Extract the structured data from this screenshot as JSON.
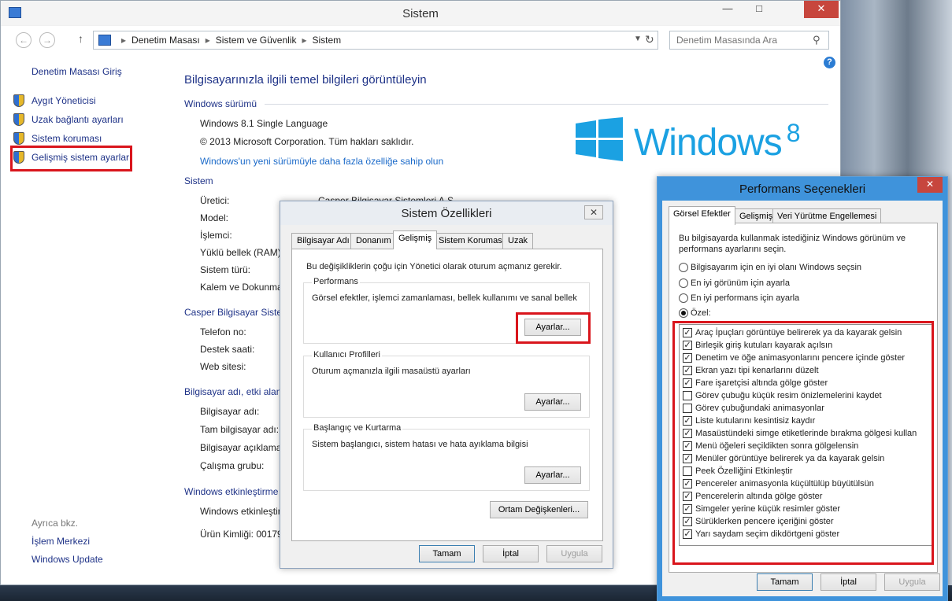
{
  "window": {
    "title": "Sistem",
    "min": "—",
    "max": "□",
    "close": "✕"
  },
  "address": {
    "crumbs": [
      "Denetim Masası",
      "Sistem ve Güvenlik",
      "Sistem"
    ],
    "search_placeholder": "Denetim Masasında Ara"
  },
  "sidebar": {
    "home": "Denetim Masası Giriş",
    "items": [
      {
        "label": "Aygıt Yöneticisi",
        "icon": "shield-icon"
      },
      {
        "label": "Uzak bağlantı ayarları",
        "icon": "shield-icon"
      },
      {
        "label": "Sistem koruması",
        "icon": "shield-icon"
      },
      {
        "label": "Gelişmiş sistem ayarları",
        "icon": "shield-icon"
      }
    ],
    "see_also": "Ayrıca bkz.",
    "see_also_items": [
      "İşlem Merkezi",
      "Windows Update"
    ]
  },
  "main": {
    "heading": "Bilgisayarınızla ilgili temel bilgileri görüntüleyin",
    "edition_head": "Windows sürümü",
    "edition": "Windows 8.1 Single Language",
    "copyright": "© 2013 Microsoft Corporation. Tüm hakları saklıdır.",
    "upgrade_link": "Windows'un yeni sürümüyle daha fazla özelliğe sahip olun",
    "logo_text": "Windows",
    "logo_version": "8",
    "system_head": "Sistem",
    "system_rows": [
      {
        "label": "Üretici:",
        "value": "Casper Bilgisayar Sistemleri A.Ş."
      },
      {
        "label": "Model:",
        "value": ""
      },
      {
        "label": "İşlemci:",
        "value": ""
      },
      {
        "label": "Yüklü bellek (RAM):",
        "value": ""
      },
      {
        "label": "Sistem türü:",
        "value": ""
      },
      {
        "label": "Kalem ve Dokunma:",
        "value": ""
      }
    ],
    "support_head": "Casper Bilgisayar Sistemleri",
    "support_rows": [
      "Telefon no:",
      "Destek saati:",
      "Web sitesi:"
    ],
    "name_head": "Bilgisayar adı, etki alanı",
    "name_rows": [
      "Bilgisayar adı:",
      "Tam bilgisayar adı:",
      "Bilgisayar açıklaması:",
      "Çalışma grubu:"
    ],
    "activation_head": "Windows etkinleştirme",
    "activation_rows": [
      "Windows etkinleştirme",
      "Ürün Kimliği: 00179"
    ]
  },
  "props_dialog": {
    "title": "Sistem Özellikleri",
    "close": "✕",
    "tabs": [
      "Bilgisayar Adı",
      "Donanım",
      "Gelişmiş",
      "Sistem Koruması",
      "Uzak"
    ],
    "admin_note": "Bu değişikliklerin çoğu için Yönetici olarak oturum açmanız gerekir.",
    "groups": [
      {
        "title": "Performans",
        "text": "Görsel efektler, işlemci zamanlaması, bellek kullanımı ve sanal bellek",
        "button": "Ayarlar..."
      },
      {
        "title": "Kullanıcı Profilleri",
        "text": "Oturum açmanızla ilgili masaüstü ayarları",
        "button": "Ayarlar..."
      },
      {
        "title": "Başlangıç ve Kurtarma",
        "text": "Sistem başlangıcı, sistem hatası ve hata ayıklama bilgisi",
        "button": "Ayarlar..."
      }
    ],
    "env_button": "Ortam Değişkenleri...",
    "ok": "Tamam",
    "cancel": "İptal",
    "apply": "Uygula"
  },
  "perf_dialog": {
    "title": "Performans Seçenekleri",
    "close": "✕",
    "tabs": [
      "Görsel Efektler",
      "Gelişmiş",
      "Veri Yürütme Engellemesi"
    ],
    "description": "Bu bilgisayarda kullanmak istediğiniz Windows görünüm ve performans ayarlarını seçin.",
    "radios": [
      {
        "label": "Bilgisayarım için en iyi olanı Windows seçsin",
        "selected": false
      },
      {
        "label": "En iyi görünüm için ayarla",
        "selected": false
      },
      {
        "label": "En iyi performans için ayarla",
        "selected": false
      },
      {
        "label": "Özel:",
        "selected": true
      }
    ],
    "options": [
      {
        "label": "Araç İpuçları görüntüye belirerek ya da kayarak gelsin",
        "checked": true
      },
      {
        "label": "Birleşik giriş kutuları kayarak açılsın",
        "checked": true
      },
      {
        "label": "Denetim ve öğe animasyonlarını pencere içinde göster",
        "checked": true
      },
      {
        "label": "Ekran yazı tipi kenarlarını düzelt",
        "checked": true
      },
      {
        "label": "Fare işaretçisi altında gölge göster",
        "checked": true
      },
      {
        "label": "Görev çubuğu küçük resim önizlemelerini kaydet",
        "checked": false
      },
      {
        "label": "Görev çubuğundaki animasyonlar",
        "checked": false
      },
      {
        "label": "Liste kutularını kesintisiz kaydır",
        "checked": true
      },
      {
        "label": "Masaüstündeki simge etiketlerinde bırakma gölgesi kullan",
        "checked": true
      },
      {
        "label": "Menü öğeleri seçildikten sonra gölgelensin",
        "checked": true
      },
      {
        "label": "Menüler görüntüye belirerek ya da kayarak gelsin",
        "checked": true
      },
      {
        "label": "Peek Özelliğini Etkinleştir",
        "checked": false
      },
      {
        "label": "Pencereler animasyonla küçültülüp büyütülsün",
        "checked": true
      },
      {
        "label": "Pencerelerin altında gölge göster",
        "checked": true
      },
      {
        "label": "Simgeler yerine küçük resimler göster",
        "checked": true
      },
      {
        "label": "Sürüklerken pencere içeriğini göster",
        "checked": true
      },
      {
        "label": "Yarı saydam seçim dikdörtgeni göster",
        "checked": true
      }
    ],
    "ok": "Tamam",
    "cancel": "İptal",
    "apply": "Uygula"
  },
  "colors": {
    "highlight": "#d9151c",
    "link": "#1e3287",
    "accent": "#1ba1e2"
  }
}
